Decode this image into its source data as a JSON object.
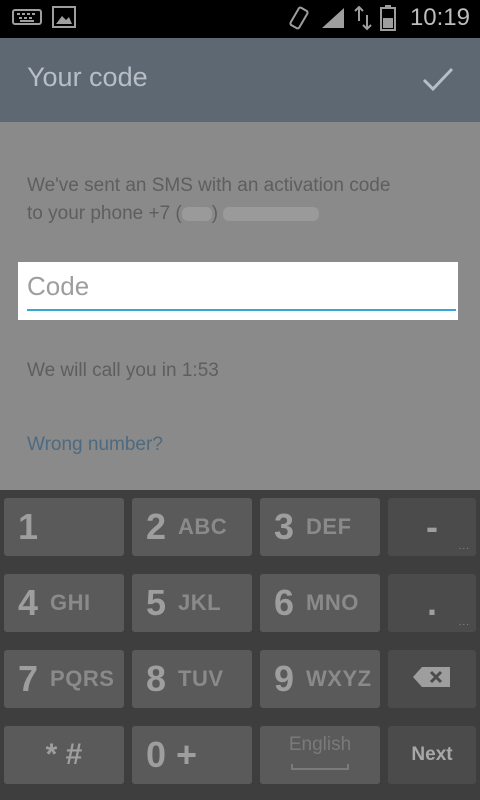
{
  "status_bar": {
    "time": "10:19",
    "icons": [
      "keyboard-icon",
      "image-icon",
      "rotate-icon",
      "signal-icon",
      "data-arrows-icon",
      "battery-icon"
    ]
  },
  "action_bar": {
    "title": "Your code",
    "confirm_icon": "check-icon"
  },
  "content": {
    "message_line1": "We've sent an SMS with an activation code",
    "message_line2_prefix": "to your phone +7 (",
    "message_line2_mid": ")",
    "code_placeholder": "Code",
    "code_value": "",
    "timer_text": "We will call you in 1:53",
    "wrong_number_link": "Wrong number?"
  },
  "keyboard": {
    "rows": [
      [
        {
          "main": "1",
          "sub": ""
        },
        {
          "main": "2",
          "sub": "ABC"
        },
        {
          "main": "3",
          "sub": "DEF"
        },
        {
          "main": "-",
          "sub": ""
        }
      ],
      [
        {
          "main": "4",
          "sub": "GHI"
        },
        {
          "main": "5",
          "sub": "JKL"
        },
        {
          "main": "6",
          "sub": "MNO"
        },
        {
          "main": ".",
          "sub": ""
        }
      ],
      [
        {
          "main": "7",
          "sub": "PQRS"
        },
        {
          "main": "8",
          "sub": "TUV"
        },
        {
          "main": "9",
          "sub": "WXYZ"
        },
        {
          "main": "",
          "sub": "backspace-icon"
        }
      ],
      [
        {
          "main": "* #",
          "sub": ""
        },
        {
          "main": "0 +",
          "sub": ""
        },
        {
          "main": "English",
          "sub": ""
        },
        {
          "main": "Next",
          "sub": ""
        }
      ]
    ]
  },
  "colors": {
    "accent_underline": "#39a6d8",
    "link": "#4d6a80",
    "action_bar": "#5d6873"
  }
}
